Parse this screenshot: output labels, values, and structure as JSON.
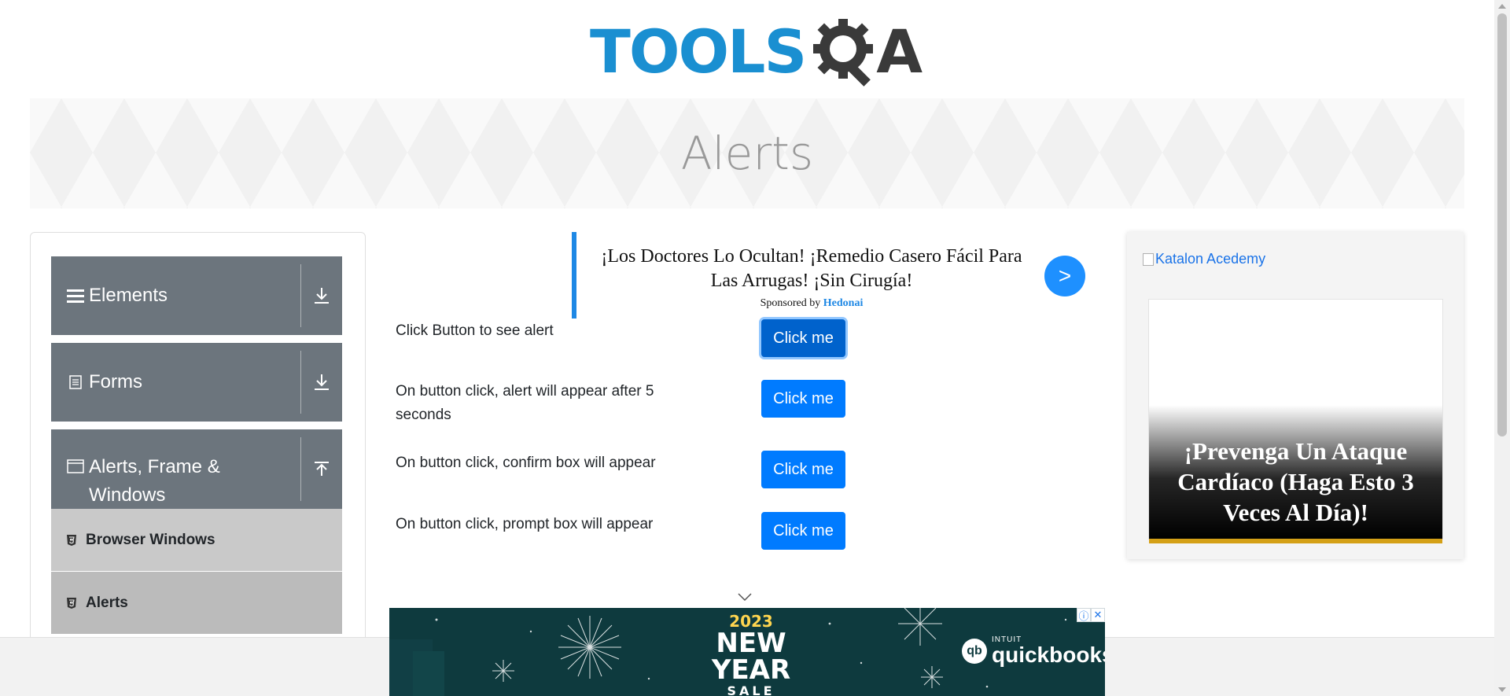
{
  "logo": {
    "part1": "TOOLS",
    "part2": "A"
  },
  "banner": {
    "title": "Alerts"
  },
  "sidebar": {
    "groups": [
      {
        "label": "Elements",
        "icon": "hamburger-icon",
        "arrow": "download-icon"
      },
      {
        "label": "Forms",
        "icon": "document-icon",
        "arrow": "download-icon"
      },
      {
        "label": "Alerts, Frame & Windows",
        "icon": "window-icon",
        "arrow": "upload-icon"
      }
    ],
    "items": [
      {
        "label": "Browser Windows",
        "icon": "html5-icon"
      },
      {
        "label": "Alerts",
        "icon": "html5-icon"
      }
    ]
  },
  "ad_top": {
    "title": "¡Los Doctores Lo Ocultan! ¡Remedio Casero Fácil Para Las Arrugas! ¡Sin Cirugía!",
    "sponsored_prefix": "Sponsored by",
    "sponsor": "Hedonai",
    "go_label": ">"
  },
  "rows": [
    {
      "text": "Click Button to see alert",
      "button": "Click me"
    },
    {
      "text": "On button click, alert will appear after 5 seconds",
      "button": "Click me"
    },
    {
      "text": "On button click, confirm box will appear",
      "button": "Click me"
    },
    {
      "text": "On button click, prompt box will appear",
      "button": "Click me"
    }
  ],
  "ad_right": {
    "alt_text": "Katalon Acedemy",
    "caption": "¡Prevenga Un Ataque Cardíaco (Haga Esto 3 Veces Al Día)!"
  },
  "ad_bottom": {
    "year": "2023",
    "line1": "NEW",
    "line2": "YEAR",
    "line3": "SALE",
    "brand_small": "INTUIT",
    "brand": "quickbooks",
    "brand_mark": "qb",
    "info": "ⓘ",
    "close": "✕"
  },
  "colors": {
    "primary": "#007bff",
    "sidebar_group": "#6c757d",
    "logo_blue": "#1a8fd1",
    "logo_dark": "#3a3a3a"
  }
}
